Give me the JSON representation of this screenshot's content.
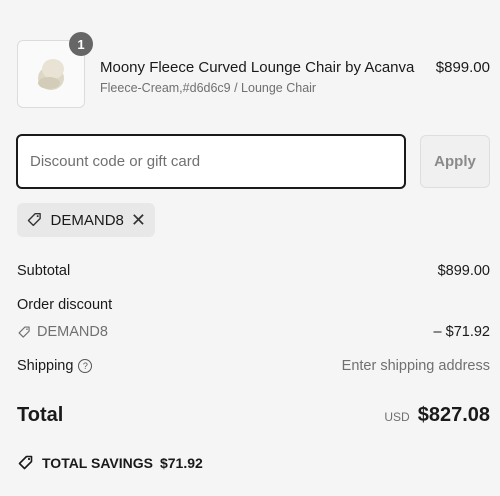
{
  "product": {
    "quantity": "1",
    "name": "Moony Fleece Curved Lounge Chair by Acanva",
    "variant": "Fleece-Cream,#d6d6c9 / Lounge Chair",
    "price": "$899.00",
    "image_icon": "lounge-chair-thumbnail"
  },
  "discount": {
    "placeholder": "Discount code or gift card",
    "apply_label": "Apply",
    "applied_code": "DEMAND8"
  },
  "summary": {
    "subtotal_label": "Subtotal",
    "subtotal_value": "$899.00",
    "order_discount_label": "Order discount",
    "discount_code": "DEMAND8",
    "discount_value": "– $71.92",
    "shipping_label": "Shipping",
    "shipping_value": "Enter shipping address",
    "total_label": "Total",
    "currency": "USD",
    "total_value": "$827.08",
    "savings_label": "TOTAL SAVINGS",
    "savings_value": "$71.92"
  },
  "colors": {
    "background": "#f5f5f5",
    "text": "#1a1a1a",
    "muted": "#707070",
    "badge": "#666666"
  }
}
